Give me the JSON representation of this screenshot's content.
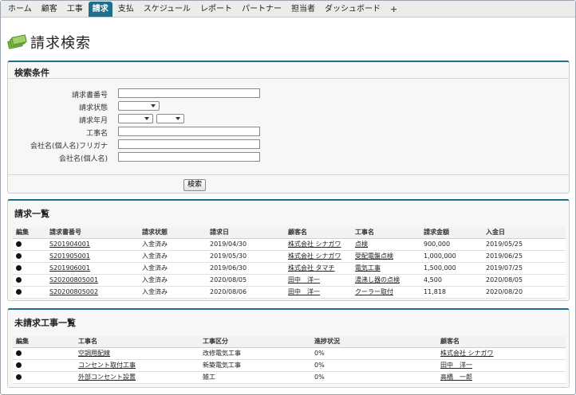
{
  "nav": {
    "tabs": [
      {
        "label": "ホーム",
        "active": false
      },
      {
        "label": "顧客",
        "active": false
      },
      {
        "label": "工事",
        "active": false
      },
      {
        "label": "請求",
        "active": true
      },
      {
        "label": "支払",
        "active": false
      },
      {
        "label": "スケジュール",
        "active": false
      },
      {
        "label": "レポート",
        "active": false
      },
      {
        "label": "パートナー",
        "active": false
      },
      {
        "label": "担当者",
        "active": false
      },
      {
        "label": "ダッシュボード",
        "active": false
      }
    ],
    "plus": "+"
  },
  "page": {
    "title": "請求検索"
  },
  "search": {
    "title": "検索条件",
    "labels": {
      "invoice_no": "請求書番号",
      "status": "請求状態",
      "year_month": "請求年月",
      "project_name": "工事名",
      "company_kana": "会社名(個人名)フリガナ",
      "company": "会社名(個人名)"
    },
    "button": "検索"
  },
  "invoices": {
    "title": "請求一覧",
    "headers": [
      "編集",
      "請求書番号",
      "請求状態",
      "請求日",
      "顧客名",
      "工事名",
      "請求金額",
      "入金日"
    ],
    "rows": [
      {
        "no": "S201904001",
        "status": "入金済み",
        "date": "2019/04/30",
        "customer": "株式会社 シナガワ",
        "project": "点検",
        "amount": "900,000",
        "paid": "2019/05/25"
      },
      {
        "no": "S201905001",
        "status": "入金済み",
        "date": "2019/05/30",
        "customer": "株式会社 シナガワ",
        "project": "受配電盤点検",
        "amount": "1,000,000",
        "paid": "2019/06/25"
      },
      {
        "no": "S201906001",
        "status": "入金済み",
        "date": "2019/06/30",
        "customer": "株式会社 タマチ",
        "project": "電気工事",
        "amount": "1,500,000",
        "paid": "2019/07/25"
      },
      {
        "no": "S20200805001",
        "status": "入金済み",
        "date": "2020/08/05",
        "customer": "田中　洋一",
        "project": "湯沸し器の点検",
        "amount": "4,500",
        "paid": "2020/08/05"
      },
      {
        "no": "S20200805002",
        "status": "入金済み",
        "date": "2020/08/06",
        "customer": "田中　洋一",
        "project": "クーラー取付",
        "amount": "11,818",
        "paid": "2020/08/20"
      }
    ]
  },
  "unbilled": {
    "title": "未請求工事一覧",
    "headers": [
      "編集",
      "工事名",
      "工事区分",
      "進捗状況",
      "顧客名"
    ],
    "rows": [
      {
        "project": "空調用配線",
        "category": "改修電気工事",
        "progress": "0%",
        "customer": "株式会社 シナガワ"
      },
      {
        "project": "コンセント取付工事",
        "category": "新築電気工事",
        "progress": "0%",
        "customer": "田中　洋一"
      },
      {
        "project": "外部コンセント設置",
        "category": "雑工",
        "progress": "0%",
        "customer": "高橋　一郎"
      }
    ]
  }
}
